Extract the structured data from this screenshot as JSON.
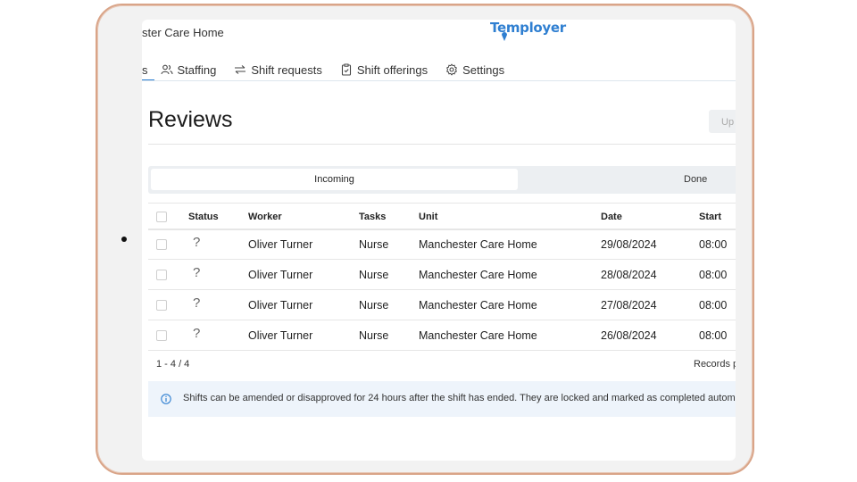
{
  "header": {
    "home_title": "ster Care Home",
    "logo_text": "Temployer"
  },
  "nav": {
    "tabs": [
      {
        "label": "s",
        "icon": "reviews-icon",
        "active": true
      },
      {
        "label": "Staffing",
        "icon": "users-icon"
      },
      {
        "label": "Shift requests",
        "icon": "arrows-swap-icon"
      },
      {
        "label": "Shift offerings",
        "icon": "clipboard-icon"
      },
      {
        "label": "Settings",
        "icon": "gear-icon"
      }
    ]
  },
  "page": {
    "title": "Reviews",
    "update_button": "Up"
  },
  "segmented": {
    "incoming": "Incoming",
    "done": "Done"
  },
  "table": {
    "columns": [
      "Status",
      "Worker",
      "Tasks",
      "Unit",
      "Date",
      "Start"
    ],
    "rows": [
      {
        "status": "?",
        "worker": "Oliver Turner",
        "tasks": "Nurse",
        "unit": "Manchester Care Home",
        "date": "29/08/2024",
        "start": "08:00"
      },
      {
        "status": "?",
        "worker": "Oliver Turner",
        "tasks": "Nurse",
        "unit": "Manchester Care Home",
        "date": "28/08/2024",
        "start": "08:00"
      },
      {
        "status": "?",
        "worker": "Oliver Turner",
        "tasks": "Nurse",
        "unit": "Manchester Care Home",
        "date": "27/08/2024",
        "start": "08:00"
      },
      {
        "status": "?",
        "worker": "Oliver Turner",
        "tasks": "Nurse",
        "unit": "Manchester Care Home",
        "date": "26/08/2024",
        "start": "08:00"
      }
    ],
    "pagination_count": "1 - 4 / 4",
    "records_label": "Records p"
  },
  "info_banner": {
    "text": "Shifts can be amended or disapproved for 24 hours after the shift has ended. They are locked and marked as completed autom"
  },
  "colors": {
    "accent": "#2f7fd1",
    "frame": "#d9a488",
    "banner_bg": "#eef4fb"
  }
}
